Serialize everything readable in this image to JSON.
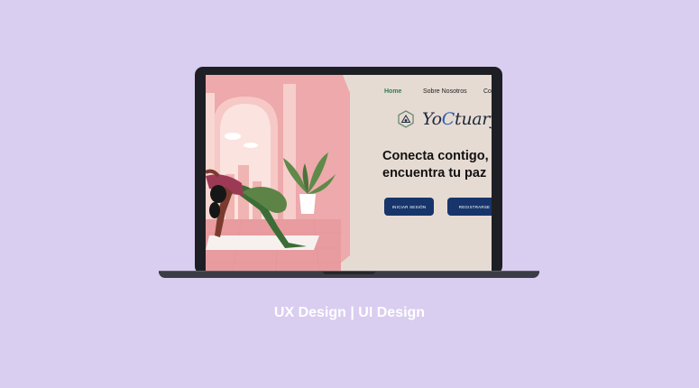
{
  "colors": {
    "background": "#d9cdf0",
    "screen_bg": "#e6dbd3",
    "hero_pink": "#eda9ab",
    "nav_active": "#2f7d52",
    "button_bg": "#17356b",
    "brand_accent": "#2c5fb0"
  },
  "site": {
    "nav": {
      "home": "Home",
      "about": "Sobre Nosotros",
      "contact_partial": "Co"
    },
    "brand": {
      "logo_icon": "hexagon-mountain-logo",
      "name_prefix": "Yo",
      "name_accent": "C",
      "name_suffix": "tuary"
    },
    "headline_line1": "Conecta contigo,",
    "headline_line2": "encuentra tu paz",
    "buttons": {
      "login": "INICIAR SESIÓN",
      "register": "REGISTRARSE"
    },
    "illustration": "woman-yoga-pose-illustration"
  },
  "caption": "UX Design | UI Design"
}
